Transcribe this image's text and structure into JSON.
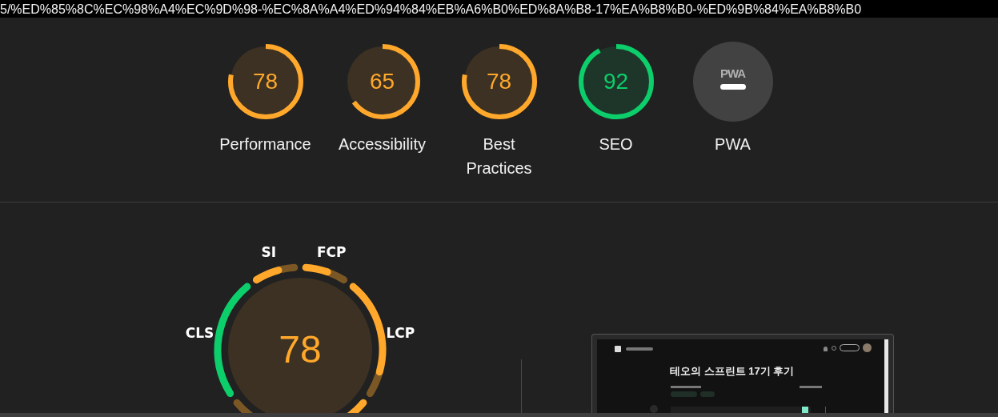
{
  "url_bar": {
    "text": "5/%ED%85%8C%EC%98%A4%EC%9D%98-%EC%8A%A4%ED%94%84%EB%A6%B0%ED%8A%B8-17%EA%B8%B0-%ED%9B%84%EA%B8%B0"
  },
  "categories": [
    {
      "kind": "score",
      "score": "78",
      "level": 0.78,
      "color": "#ffa82b",
      "label": "Performance"
    },
    {
      "kind": "score",
      "score": "65",
      "level": 0.65,
      "color": "#ffa82b",
      "label": "Accessibility"
    },
    {
      "kind": "score",
      "score": "78",
      "level": 0.78,
      "color": "#ffa82b",
      "label": "Best Practices"
    },
    {
      "kind": "score",
      "score": "92",
      "level": 0.92,
      "color": "#0cce6b",
      "label": "SEO"
    },
    {
      "kind": "pwa",
      "logo": "PWA",
      "label": "PWA"
    }
  ],
  "performance_gauge": {
    "score": "78",
    "color": "#ffa82b",
    "metrics": [
      {
        "label": "FCP",
        "level": 0.55,
        "color": "#ffa82b"
      },
      {
        "label": "LCP",
        "level": 0.8,
        "color": "#ffa82b"
      },
      {
        "level": 0.45,
        "color": "#ffa82b"
      },
      {
        "label": "CLS",
        "level": 1,
        "color": "#0cce6b"
      },
      {
        "label": "SI",
        "level": 0.6,
        "color": "#ffa82b"
      }
    ]
  },
  "preview": {
    "title": "테오의 스프린트 17기 후기"
  }
}
